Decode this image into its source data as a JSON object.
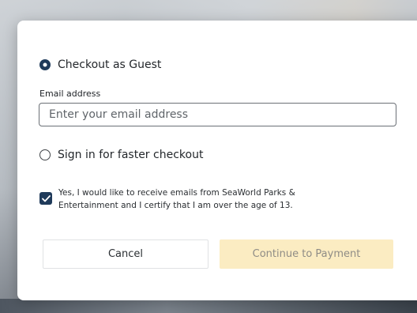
{
  "options": {
    "guest_label": "Checkout as Guest",
    "signin_label": "Sign in for faster checkout"
  },
  "email": {
    "label": "Email address",
    "placeholder": "Enter your email address",
    "value": ""
  },
  "consent": {
    "checked": true,
    "text": "Yes, I would like to receive emails from SeaWorld Parks & Entertainment and I certify that I am over the age of 13."
  },
  "buttons": {
    "cancel_label": "Cancel",
    "continue_label": "Continue to Payment"
  },
  "colors": {
    "accent": "#1f3a5a",
    "continue_bg": "#fbecc2"
  }
}
